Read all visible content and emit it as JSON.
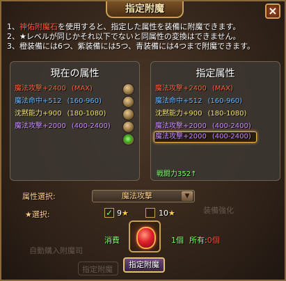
{
  "window": {
    "title": "指定附魔",
    "close": "×"
  },
  "instructions": {
    "line1_prefix": "1、",
    "line1_highlight": "神佑附魔石",
    "line1_rest": "を使用すると、指定した属性を装備に附魔できます。",
    "line2": "2、★レベルが同じかそれ以下でないと同属性の変換はできません。",
    "line3": "3、橙装備には6つ、紫装備には5つ、青装備には4つまで附魔できます。"
  },
  "current": {
    "title": "現在の属性",
    "rows": [
      {
        "name": "魔法攻撃",
        "value": "+2400",
        "range": "(MAX)"
      },
      {
        "name": "魔法命中",
        "value": "+512",
        "range": "(160-960)"
      },
      {
        "name": "沈黙能力",
        "value": "+900",
        "range": "(180-1080)"
      },
      {
        "name": "魔法攻撃",
        "value": "+2000",
        "range": "(400-2400)"
      }
    ]
  },
  "target": {
    "title": "指定属性",
    "rows": [
      {
        "name": "魔法攻撃",
        "value": "+2400",
        "range": "(MAX)"
      },
      {
        "name": "魔法命中",
        "value": "+512",
        "range": "(160-960)"
      },
      {
        "name": "沈黙能力",
        "value": "+900",
        "range": "(180-1080)"
      },
      {
        "name": "魔法攻撃",
        "value": "+2000",
        "range": "(400-2400)"
      },
      {
        "name": "魔法攻撃",
        "value": "+2000",
        "range": "(400-2400)"
      }
    ],
    "combat_power": "戦闘力352↑"
  },
  "attribute_select": {
    "label": "属性選択:",
    "value": "魔法攻撃",
    "arrow": "▼"
  },
  "star_select": {
    "label": "★選択:",
    "option1": {
      "num": "9",
      "star": "★",
      "checked": true,
      "mark": "✓"
    },
    "option2": {
      "num": "10",
      "star": "★",
      "checked": false,
      "mark": ""
    }
  },
  "consume": {
    "label": "消費",
    "count": "1個",
    "owned_label": "所有:",
    "owned_value": "0個"
  },
  "confirm_button": "指定附魔",
  "background_hints": {
    "auto_buy": "自動購入附魔司",
    "enhance": "装備強化",
    "bottom_btn": "指定附魔"
  },
  "colors": {
    "attack": "#ff5a3c",
    "hit": "#63b4ff",
    "silence": "#f0e070",
    "attack2": "#c88aff",
    "green": "#7aff6a",
    "gold": "#c9a155"
  }
}
